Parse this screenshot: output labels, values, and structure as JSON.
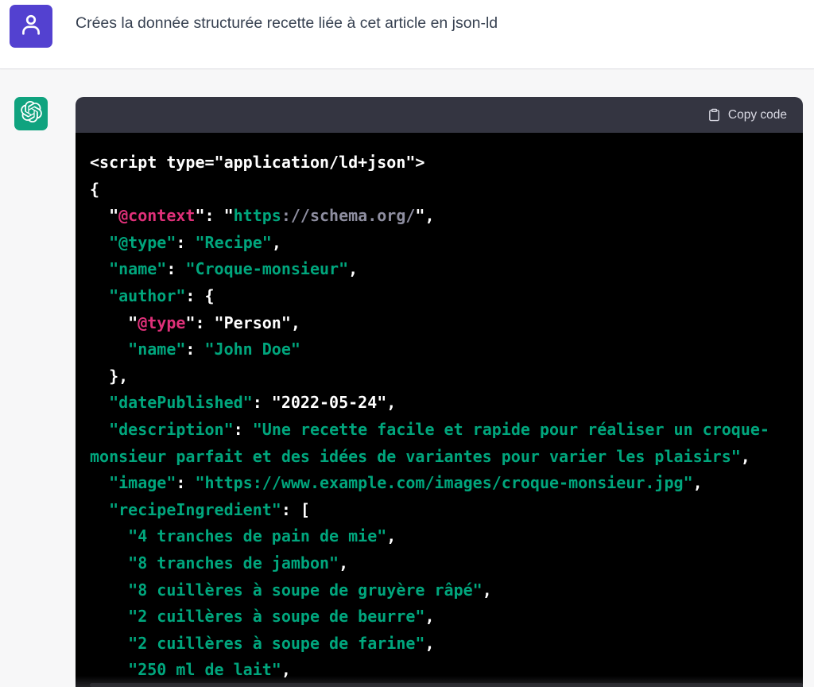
{
  "colors": {
    "page-top-bg": "#ffffff",
    "page-bottom-bg": "#f7f7f8",
    "divider": "#e3e3e8",
    "user-text": "#374151",
    "user-avatar-bg": "#5341d0",
    "bot-avatar-bg": "#10a37f",
    "header-bg": "#343541",
    "header-text": "#d9d9e3",
    "code-bg": "#000000",
    "code-plain": "#ffffff",
    "code-key": "#df3079",
    "code-string": "#00a67d",
    "code-url": "#8e8ea0"
  },
  "user_message": {
    "text": "Crées la donnée structurée recette liée à cet article en json-ld",
    "avatar_icon": "user-icon"
  },
  "assistant": {
    "avatar_icon": "openai-logo-icon"
  },
  "code_block": {
    "header": {
      "copy_label": "Copy code",
      "copy_icon": "clipboard-icon"
    },
    "language_hint": "json-ld",
    "lines": [
      [
        {
          "text": "<script type=\"application/ld+json\">",
          "role": "plain"
        }
      ],
      [
        {
          "text": "{",
          "role": "plain"
        }
      ],
      [
        {
          "text": "  \"",
          "role": "plain"
        },
        {
          "text": "@context",
          "role": "key"
        },
        {
          "text": "\": \"",
          "role": "plain"
        },
        {
          "text": "https",
          "role": "string"
        },
        {
          "text": "://schema.org/",
          "role": "url"
        },
        {
          "text": "\",",
          "role": "plain"
        }
      ],
      [
        {
          "text": "  ",
          "role": "plain"
        },
        {
          "text": "\"@type\"",
          "role": "string"
        },
        {
          "text": ": ",
          "role": "plain"
        },
        {
          "text": "\"Recipe\"",
          "role": "string"
        },
        {
          "text": ",",
          "role": "plain"
        }
      ],
      [
        {
          "text": "  ",
          "role": "plain"
        },
        {
          "text": "\"name\"",
          "role": "string"
        },
        {
          "text": ": ",
          "role": "plain"
        },
        {
          "text": "\"Croque-monsieur\"",
          "role": "string"
        },
        {
          "text": ",",
          "role": "plain"
        }
      ],
      [
        {
          "text": "  ",
          "role": "plain"
        },
        {
          "text": "\"author\"",
          "role": "string"
        },
        {
          "text": ": {",
          "role": "plain"
        }
      ],
      [
        {
          "text": "    \"",
          "role": "plain"
        },
        {
          "text": "@type",
          "role": "key"
        },
        {
          "text": "\": \"Person\",",
          "role": "plain"
        }
      ],
      [
        {
          "text": "    ",
          "role": "plain"
        },
        {
          "text": "\"name\"",
          "role": "string"
        },
        {
          "text": ": ",
          "role": "plain"
        },
        {
          "text": "\"John Doe\"",
          "role": "string"
        }
      ],
      [
        {
          "text": "  },",
          "role": "plain"
        }
      ],
      [
        {
          "text": "  ",
          "role": "plain"
        },
        {
          "text": "\"datePublished\"",
          "role": "string"
        },
        {
          "text": ": \"2022-05-24\",",
          "role": "plain"
        }
      ],
      [
        {
          "text": "  ",
          "role": "plain"
        },
        {
          "text": "\"description\"",
          "role": "string"
        },
        {
          "text": ": ",
          "role": "plain"
        },
        {
          "text": "\"Une recette facile et rapide pour réaliser un croque-",
          "role": "string"
        }
      ],
      [
        {
          "text": "monsieur parfait et des idées de variantes pour varier les plaisirs\"",
          "role": "string"
        },
        {
          "text": ",",
          "role": "plain"
        }
      ],
      [
        {
          "text": "  ",
          "role": "plain"
        },
        {
          "text": "\"image\"",
          "role": "string"
        },
        {
          "text": ": ",
          "role": "plain"
        },
        {
          "text": "\"https://www.example.com/images/croque-monsieur.jpg\"",
          "role": "string"
        },
        {
          "text": ",",
          "role": "plain"
        }
      ],
      [
        {
          "text": "  ",
          "role": "plain"
        },
        {
          "text": "\"recipeIngredient\"",
          "role": "string"
        },
        {
          "text": ": [",
          "role": "plain"
        }
      ],
      [
        {
          "text": "    ",
          "role": "plain"
        },
        {
          "text": "\"4 tranches de pain de mie\"",
          "role": "string"
        },
        {
          "text": ",",
          "role": "plain"
        }
      ],
      [
        {
          "text": "    ",
          "role": "plain"
        },
        {
          "text": "\"8 tranches de jambon\"",
          "role": "string"
        },
        {
          "text": ",",
          "role": "plain"
        }
      ],
      [
        {
          "text": "    ",
          "role": "plain"
        },
        {
          "text": "\"8 cuillères à soupe de gruyère râpé\"",
          "role": "string"
        },
        {
          "text": ",",
          "role": "plain"
        }
      ],
      [
        {
          "text": "    ",
          "role": "plain"
        },
        {
          "text": "\"2 cuillères à soupe de beurre\"",
          "role": "string"
        },
        {
          "text": ",",
          "role": "plain"
        }
      ],
      [
        {
          "text": "    ",
          "role": "plain"
        },
        {
          "text": "\"2 cuillères à soupe de farine\"",
          "role": "string"
        },
        {
          "text": ",",
          "role": "plain"
        }
      ],
      [
        {
          "text": "    ",
          "role": "plain"
        },
        {
          "text": "\"250 ml de lait\"",
          "role": "string"
        },
        {
          "text": ",",
          "role": "plain"
        }
      ]
    ]
  }
}
